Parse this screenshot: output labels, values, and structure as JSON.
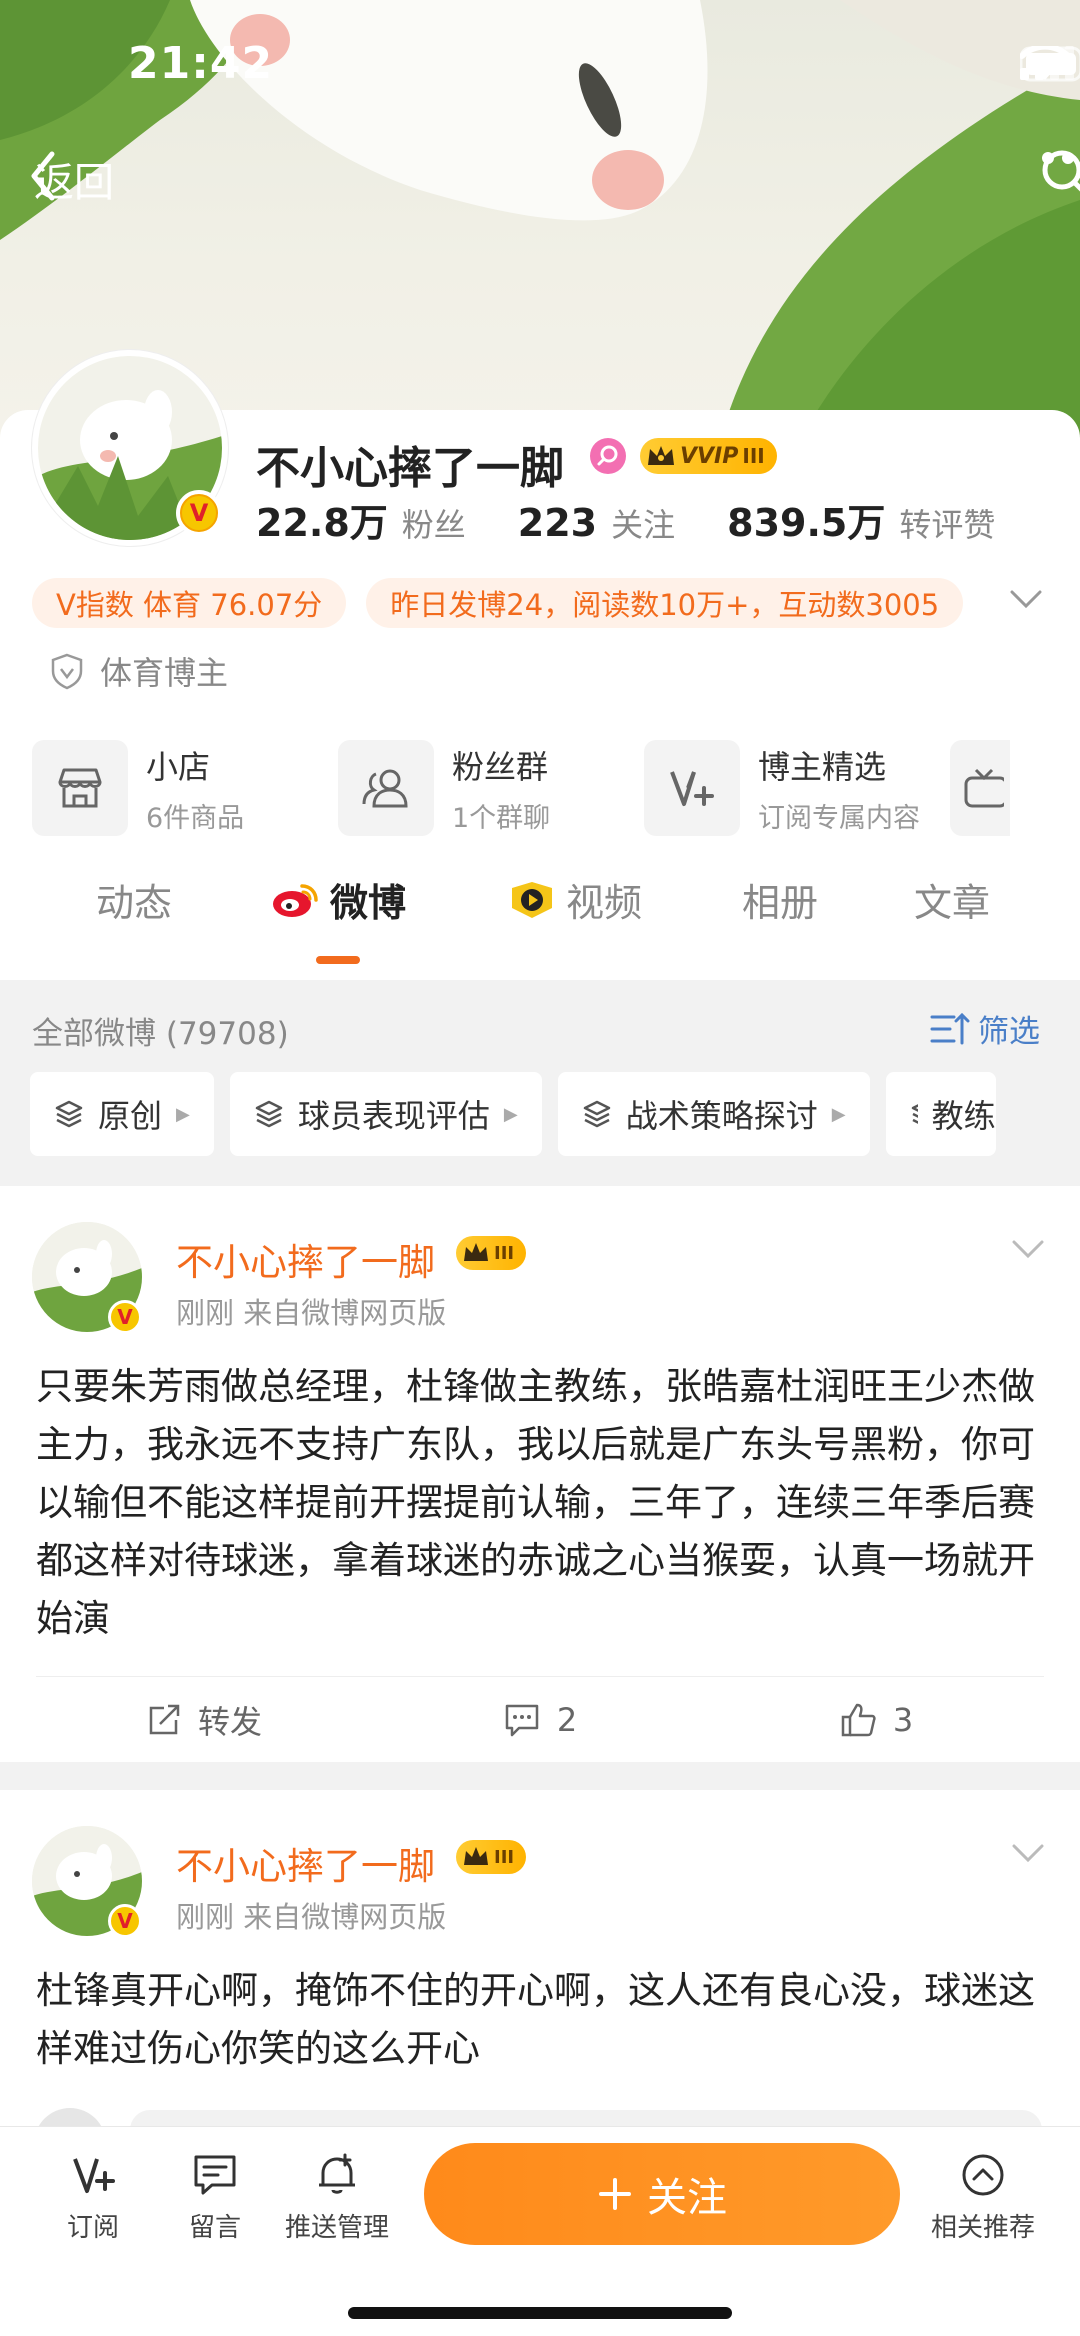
{
  "status": {
    "time": "21:42"
  },
  "nav": {
    "back_label": "返回"
  },
  "profile": {
    "name": "不小心摔了一脚",
    "vip_label": "VVIP",
    "vip_level": "III",
    "v_mark": "V",
    "stats": [
      {
        "value": "22.8万",
        "label": "粉丝"
      },
      {
        "value": "223",
        "label": "关注"
      },
      {
        "value": "839.5万",
        "label": "转评赞"
      }
    ],
    "chips": [
      "V指数 体育 76.07分",
      "昨日发博24，阅读数10万+，互动数3005"
    ],
    "verified_label": "体育博主",
    "services": [
      {
        "title": "小店",
        "subtitle": "6件商品",
        "icon": "shop-icon"
      },
      {
        "title": "粉丝群",
        "subtitle": "1个群聊",
        "icon": "fans-group-icon"
      },
      {
        "title": "博主精选",
        "subtitle": "订阅专属内容",
        "icon": "v-plus-icon"
      }
    ]
  },
  "tabs": [
    {
      "label": "动态"
    },
    {
      "label": "微博",
      "active": true
    },
    {
      "label": "视频"
    },
    {
      "label": "相册"
    },
    {
      "label": "文章"
    }
  ],
  "filters": {
    "all_count_label": "全部微博 (79708)",
    "filter_label": "筛选",
    "tags": [
      "原创",
      "球员表现评估",
      "战术策略探讨",
      "教练"
    ]
  },
  "posts": [
    {
      "author": "不小心摔了一脚",
      "crown_level": "III",
      "meta": "刚刚  来自微博网页版",
      "text": "只要朱芳雨做总经理，杜锋做主教练，张皓嘉杜润旺王少杰做主力，我永远不支持广东队，我以后就是广东头号黑粉，你可以输但不能这样提前开摆提前认输，三年了，连续三年季后赛都这样对待球迷，拿着球迷的赤诚之心当猴耍，认真一场就开始演",
      "repost_label": "转发",
      "comments": "2",
      "likes": "3"
    },
    {
      "author": "不小心摔了一脚",
      "crown_level": "III",
      "meta": "刚刚  来自微博网页版",
      "text": "杜锋真开心啊，掩饰不住的开心啊，这人还有良心没，球迷这样难过伤心你笑的这么开心"
    }
  ],
  "bottom_bar": {
    "items": [
      {
        "label": "订阅",
        "icon": "v-plus-icon"
      },
      {
        "label": "留言",
        "icon": "message-icon"
      },
      {
        "label": "推送管理",
        "icon": "bell-icon"
      }
    ],
    "follow_label": "关注",
    "recommend_label": "相关推荐"
  },
  "colors": {
    "accent": "#f26b1d",
    "link": "#4a7fc8",
    "follow_button": "#ff8a1a"
  }
}
